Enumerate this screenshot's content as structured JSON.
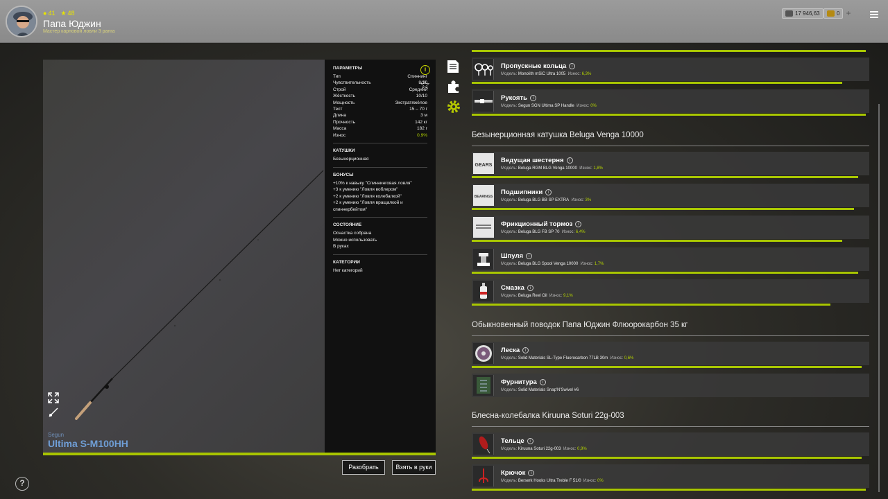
{
  "header": {
    "player_name": "Папа Юджин",
    "player_rank": "Мастер карповой ловли 3 ранга",
    "level": "41",
    "stars": "48",
    "silver": "17 946,63",
    "gold": "0",
    "add_label": "+"
  },
  "rod": {
    "brand": "Segun",
    "model": "Ultima S-M100HH",
    "wear_fraction": 1.0
  },
  "params": {
    "title": "ПАРАМЕТРЫ",
    "rows": [
      {
        "k": "Тип",
        "v": "Спиннинг"
      },
      {
        "k": "Чувствительность",
        "v": "8/10"
      },
      {
        "k": "Строй",
        "v": "Средний"
      },
      {
        "k": "Жёсткость",
        "v": "10/10"
      },
      {
        "k": "Мощность",
        "v": "Экстратяжёлое"
      },
      {
        "k": "Тест",
        "v": "15 – 70 г"
      },
      {
        "k": "Длина",
        "v": "3 м"
      },
      {
        "k": "Прочность",
        "v": "142 кг"
      },
      {
        "k": "Масса",
        "v": "182 г"
      },
      {
        "k": "Износ",
        "v": "0,9%"
      }
    ],
    "reels_title": "КАТУШКИ",
    "reels_value": "Безынерционная",
    "bonuses_title": "БОНУСЫ",
    "bonuses": [
      "+10% к навыку \"Спиннинговая ловля\"",
      "+3 к умению \"Ловля воблером\"",
      "+2 к умению \"Ловля колебалкой\"",
      "+2 к умению \"Ловля вращалкой и спиннербейтом\""
    ],
    "state_title": "СОСТОЯНИЕ",
    "states": [
      "Оснастка собрана",
      "Можно использовать",
      "В руках"
    ],
    "categories_title": "КАТЕГОРИИ",
    "categories_value": "Нет категорий"
  },
  "buttons": {
    "disassemble": "Разобрать",
    "take": "Взять в руки"
  },
  "labels": {
    "model": "Модель:",
    "wear": "Износ:"
  },
  "sections": [
    {
      "title": ""
    },
    {
      "title": "Безынерционная катушка   Beluga Venga 10000"
    },
    {
      "title": "Обыкновенный поводок   Папа Юджин Флюорокарбон 35 кг"
    },
    {
      "title": "Блесна-колебалка   Kiruuna Soturi 22g-003"
    }
  ],
  "items": [
    {
      "name": "Пропускные кольца",
      "model": "Monolith mSiC Ultra 1005",
      "wear": "6,3%",
      "fill": 0.94,
      "thumb": "rings-icon"
    },
    {
      "name": "Рукоять",
      "model": "Segun SGN Ultima SP Handle",
      "wear": "0%",
      "fill": 1.0,
      "thumb": "handle-icon"
    },
    {
      "name": "Ведущая шестерня",
      "model": "Beluga RGM BLG Venga 10000",
      "wear": "1,8%",
      "fill": 0.98,
      "thumb": "gears-icon"
    },
    {
      "name": "Подшипники",
      "model": "Beluga BLG BB SP EXTRA",
      "wear": "3%",
      "fill": 0.97,
      "thumb": "bearings-icon"
    },
    {
      "name": "Фрикционный тормоз",
      "model": "Beluga BLG FB SP 70",
      "wear": "6,4%",
      "fill": 0.94,
      "thumb": "drag-icon"
    },
    {
      "name": "Шпуля",
      "model": "Beluga BLG Spool Venga 10000",
      "wear": "1,7%",
      "fill": 0.98,
      "thumb": "spool-icon"
    },
    {
      "name": "Смазка",
      "model": "Beluga Reel Oil",
      "wear": "9,1%",
      "fill": 0.91,
      "thumb": "oil-icon"
    },
    {
      "name": "Леска",
      "model": "Solid Materials SL-Type Fluorocarbon 77LB 30m",
      "wear": "0,6%",
      "fill": 0.99,
      "thumb": "line-icon"
    },
    {
      "name": "Фурнитура",
      "model": "Solid Materials Snap'N'Swivel #6",
      "wear": "",
      "fill": 0,
      "thumb": "swivel-icon"
    },
    {
      "name": "Тельце",
      "model": "Kiruuna Soturi 22g-003",
      "wear": "0,9%",
      "fill": 0.99,
      "thumb": "spoon-icon"
    },
    {
      "name": "Крючок",
      "model": "Berserk Hooks Ultra Treble F 51/0",
      "wear": "0%",
      "fill": 1.0,
      "thumb": "hook-icon"
    }
  ],
  "colors": {
    "accent": "#a9c700",
    "bonus": "#7fa6e0",
    "panel": "#111111"
  }
}
